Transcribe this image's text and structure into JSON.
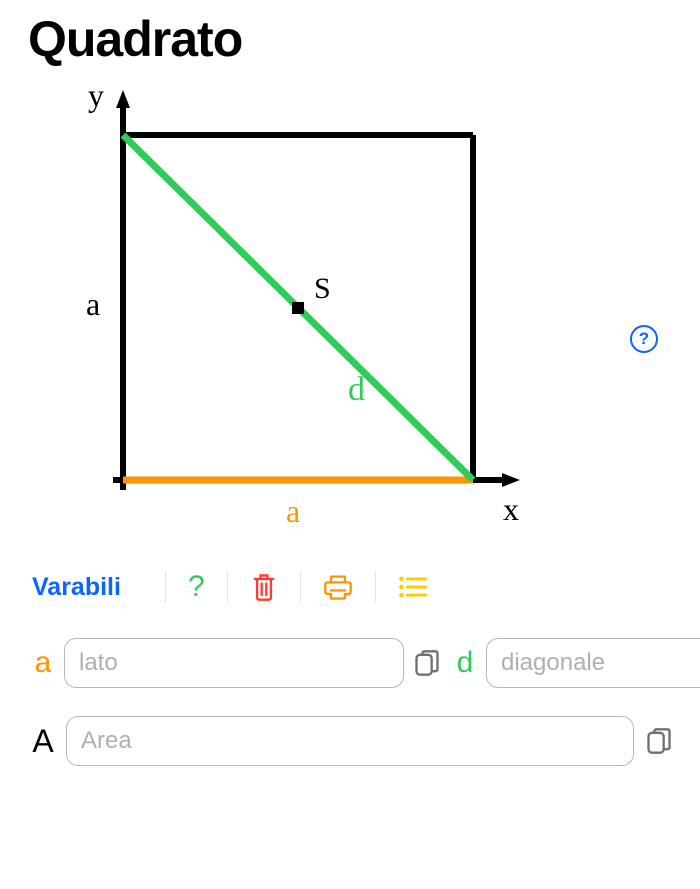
{
  "title": "Quadrato",
  "diagram": {
    "axis_y_label": "y",
    "axis_x_label": "x",
    "side_label": "a",
    "bottom_label": "a",
    "diagonal_label": "d",
    "center_label": "S"
  },
  "help_icon_text": "?",
  "toolbar": {
    "label": "Varabili",
    "help_text": "?"
  },
  "inputs": {
    "a": {
      "symbol": "a",
      "placeholder": "lato"
    },
    "d": {
      "symbol": "d",
      "placeholder": "diagonale"
    },
    "A": {
      "symbol": "A",
      "placeholder": "Area"
    }
  },
  "colors": {
    "blue": "#0a66ff",
    "green": "#2fcc5a",
    "orange": "#ff9500",
    "red": "#ff3b30",
    "yellow": "#ffcc00"
  }
}
